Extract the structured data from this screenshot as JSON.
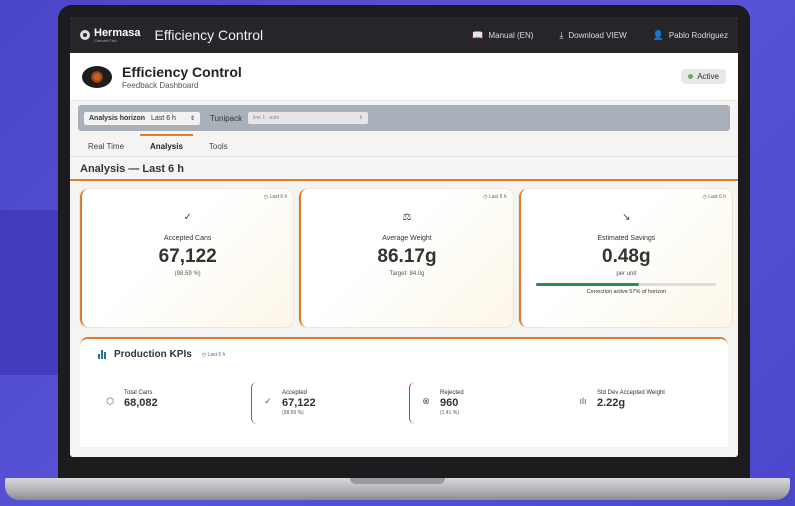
{
  "brand": {
    "name": "Hermasa",
    "tagline": "Canned Fish"
  },
  "topbar": {
    "title": "Efficiency Control",
    "manual": "Manual (EN)",
    "download": "Download VIEW",
    "user": "Pablo Rodriguez"
  },
  "header": {
    "title": "Efficiency Control",
    "subtitle": "Feedback Dashboard",
    "status": "Active"
  },
  "filters": {
    "horizon_label": "Analysis horizon",
    "horizon_value": "Last 6 h",
    "tunipack_label": "Tunipack",
    "tunipack_value": "line 1 · auto"
  },
  "tabs": [
    "Real Time",
    "Analysis",
    "Tools"
  ],
  "section_title": "Analysis — Last 6 h",
  "cards": [
    {
      "tag": "◷ Last 6 h",
      "icon": "check-circle-icon",
      "icon_glyph": "✓",
      "label": "Accepted Cans",
      "value": "67,122",
      "sub": "(98.59 %)"
    },
    {
      "tag": "◷ Last 6 h",
      "icon": "scale-icon",
      "icon_glyph": "⚖",
      "label": "Average Weight",
      "value": "86.17g",
      "sub": "Target: 84.0g"
    },
    {
      "tag": "◷ Last 6 h",
      "icon": "trend-down-icon",
      "icon_glyph": "↘",
      "label": "Estimated Savings",
      "value": "0.48g",
      "sub": "per unit",
      "progress": 0.57,
      "progress_caption": "Correction active 57% of horizon"
    }
  ],
  "kpi": {
    "title": "Production KPIs",
    "tag": "◷ Last 6 h",
    "items": [
      {
        "icon_glyph": "⬡",
        "label": "Total Cans",
        "value": "68,082",
        "sub": ""
      },
      {
        "icon_glyph": "✓",
        "label": "Accepted",
        "value": "67,122",
        "sub": "(98.59 %)"
      },
      {
        "icon_glyph": "⊗",
        "label": "Rejected",
        "value": "960",
        "sub": "(1.41 %)"
      },
      {
        "icon_glyph": "ılı",
        "label": "Std Dev Accepted Weight",
        "value": "2.22g",
        "sub": ""
      }
    ]
  },
  "colors": {
    "accent": "#e07b2a",
    "success": "#2e8b57",
    "danger": "#c0392b",
    "background": "#4a44c8"
  }
}
